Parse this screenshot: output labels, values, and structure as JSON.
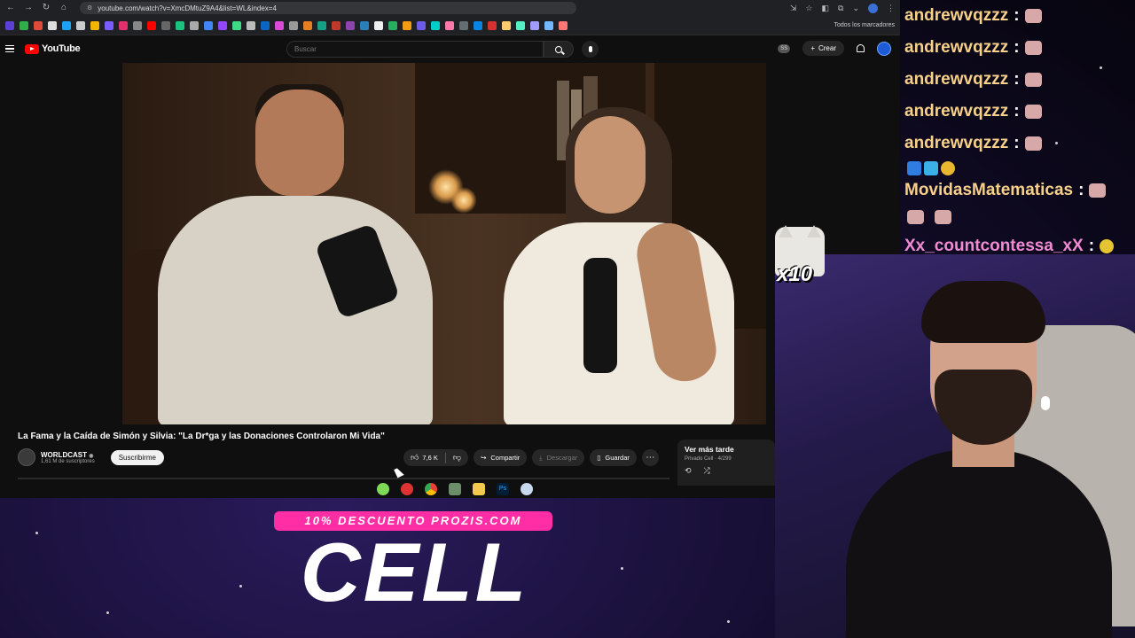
{
  "browser": {
    "url": "youtube.com/watch?v=XmcDMtuZ9A4&list=WL&index=4",
    "bookmarks_folder_label": "Todos los marcadores"
  },
  "youtube": {
    "logo_text": "YouTube",
    "search_placeholder": "Buscar",
    "create_label": "Crear",
    "header_badge": "SS"
  },
  "video": {
    "title": "La Fama y la Caída de Simón y Silvia: \"La Dr*ga y las Donaciones Controlaron Mi Vida\"",
    "channel_name": "WORLDCAST",
    "channel_verified": "◉",
    "channel_subscribers": "1,61 M de suscriptores",
    "subscribe_label": "Suscribirme",
    "like_count": "7,6 K",
    "share_label": "Compartir",
    "download_label": "Descargar",
    "save_label": "Guardar"
  },
  "playlist": {
    "title": "Ver más tarde",
    "subtitle": "Privado Cell · 4/299"
  },
  "sponsor": {
    "badge_text": "10% DESCUENTO PROZIS.COM",
    "code_text": "CELL"
  },
  "chat": {
    "messages": [
      {
        "user": "andrewvqzzz",
        "colon": ":"
      },
      {
        "user": "andrewvqzzz",
        "colon": ":"
      },
      {
        "user": "andrewvqzzz",
        "colon": ":"
      },
      {
        "user": "andrewvqzzz",
        "colon": ":"
      },
      {
        "user": "andrewvqzzz",
        "colon": ":"
      },
      {
        "user": "MovidasMatematicas",
        "colon": ":"
      },
      {
        "user": "Xx_countcontessa_xX",
        "colon": ":"
      }
    ]
  },
  "overlay": {
    "multiplier": "x10"
  },
  "colors": {
    "youtube_red": "#ff0000",
    "chat_username": "#f7d08a",
    "chat_username_alt": "#f08bd2",
    "sponsor_pink": "#ff2ea5"
  }
}
